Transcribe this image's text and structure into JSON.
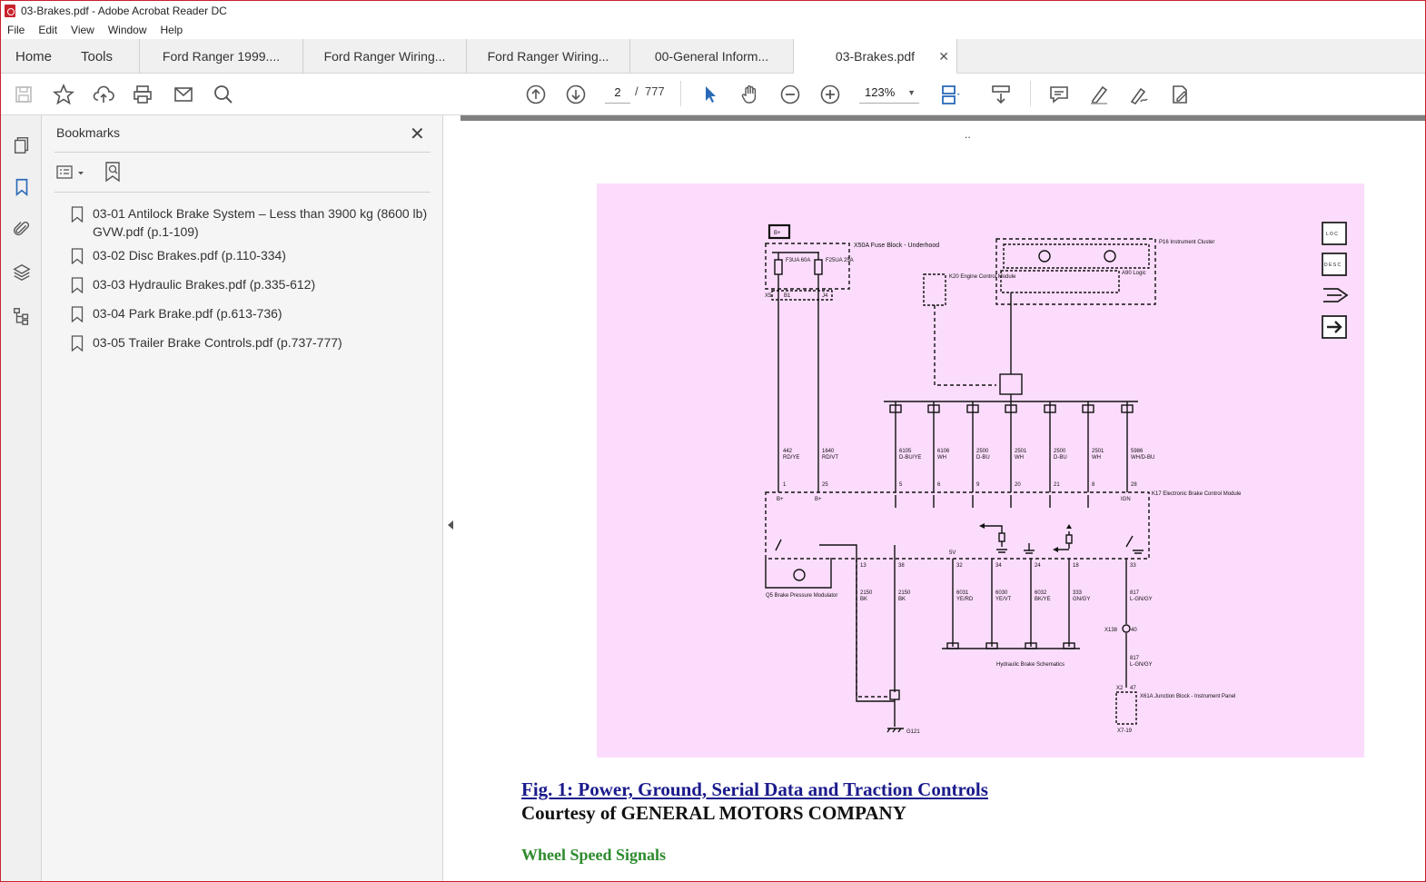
{
  "window": {
    "title": "03-Brakes.pdf - Adobe Acrobat Reader DC"
  },
  "menu": [
    "File",
    "Edit",
    "View",
    "Window",
    "Help"
  ],
  "tabs": {
    "home": "Home",
    "tools": "Tools",
    "documents": [
      {
        "label": "Ford Ranger 1999...."
      },
      {
        "label": "Ford Ranger Wiring..."
      },
      {
        "label": "Ford Ranger Wiring..."
      },
      {
        "label": "00-General Inform..."
      },
      {
        "label": "03-Brakes.pdf",
        "active": true
      }
    ],
    "close_glyph": "✕"
  },
  "toolbar": {
    "current_page": "2",
    "page_separator": "/",
    "total_pages": "777",
    "zoom": "123%"
  },
  "bookmarks": {
    "title": "Bookmarks",
    "close_glyph": "✕",
    "items": [
      {
        "label": "03-01 Antilock Brake System – Less than 3900 kg (8600 lb) GVW.pdf (p.1-109)"
      },
      {
        "label": "03-02 Disc Brakes.pdf (p.110-334)"
      },
      {
        "label": "03-03 Hydraulic Brakes.pdf (p.335-612)"
      },
      {
        "label": "03-04 Park Brake.pdf (p.613-736)"
      },
      {
        "label": "03-05 Trailer Brake Controls.pdf (p.737-777)"
      }
    ]
  },
  "document": {
    "header_mark": "..",
    "figure_caption": "Fig. 1: Power, Ground, Serial Data and Traction Controls",
    "courtesy": "Courtesy of GENERAL MOTORS COMPANY",
    "next_section": "Wheel Speed Signals"
  },
  "diagram": {
    "battery": "B+",
    "fuse_block": "X50A Fuse Block - Underhood",
    "fuse1": "F3UA 60A",
    "fuse2": "F25UA 25A",
    "x5": "X5",
    "b1": "B1",
    "j4": "J4",
    "ecm": "K20 Engine Control Module",
    "cluster": "P16 Instrument Cluster",
    "a90": "A90 Logic",
    "ebcm": "K17 Electronic Brake Control Module",
    "modulator": "Q5 Brake Pressure Modulator",
    "ground": "G121",
    "hydraulic": "Hydraulic Brake Schematics",
    "x138": "X138",
    "x138_pin": "40",
    "junction": "X61A Junction Block - Instrument Panel",
    "x2": "X2",
    "x2_pin": "47",
    "x7": "X7-19",
    "power_wires": [
      {
        "circuit": "442",
        "color": "RD/YE",
        "pin": "1",
        "label": "B+"
      },
      {
        "circuit": "1640",
        "color": "RD/VT",
        "pin": "25",
        "label": "B+"
      }
    ],
    "data_wires": [
      {
        "circuit": "6105",
        "color": "D-BU/YE",
        "pin": "5"
      },
      {
        "circuit": "6106",
        "color": "WH",
        "pin": "6"
      },
      {
        "circuit": "2500",
        "color": "D-BU",
        "pin": "9"
      },
      {
        "circuit": "2501",
        "color": "WH",
        "pin": "20"
      },
      {
        "circuit": "2500",
        "color": "D-BU",
        "pin": "21"
      },
      {
        "circuit": "2501",
        "color": "WH",
        "pin": "8"
      },
      {
        "circuit": "5986",
        "color": "WH/D-BU",
        "pin": "28",
        "label": "IGN"
      }
    ],
    "lower_wires": [
      {
        "circuit": "2150",
        "color": "BK",
        "pin": "13"
      },
      {
        "circuit": "2150",
        "color": "BK",
        "pin": "38"
      },
      {
        "circuit": "6031",
        "color": "YE/RD",
        "pin": "32",
        "label": "5V"
      },
      {
        "circuit": "6030",
        "color": "YE/VT",
        "pin": "34"
      },
      {
        "circuit": "6032",
        "color": "BK/YE",
        "pin": "24"
      },
      {
        "circuit": "333",
        "color": "GN/GY",
        "pin": "18"
      },
      {
        "circuit": "817",
        "color": "L-GN/GY",
        "pin": "33"
      }
    ],
    "lower_817": {
      "circuit": "817",
      "color": "L-GN/GY"
    },
    "nav_loc": "L O C",
    "nav_desc": "D E S C"
  }
}
